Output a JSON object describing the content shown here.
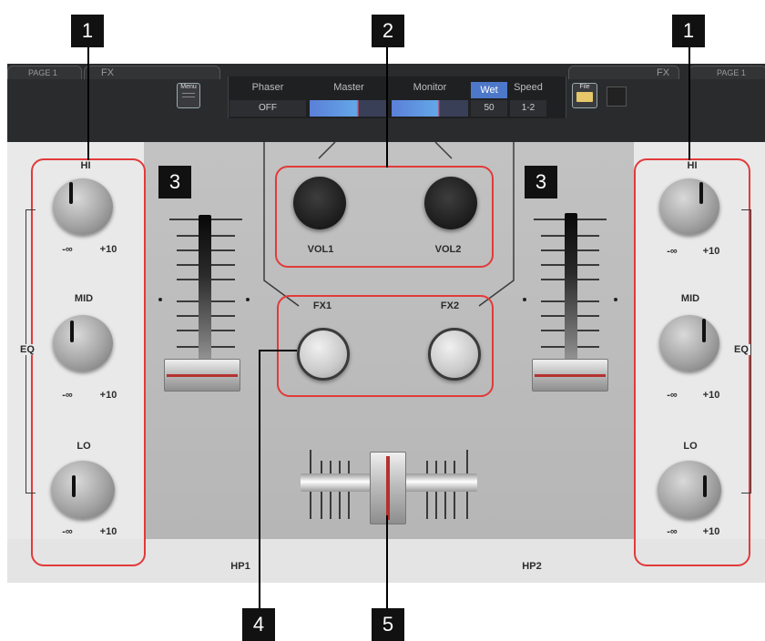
{
  "callouts": {
    "c1_left": "1",
    "c1_right": "1",
    "c2": "2",
    "c3_left": "3",
    "c3_right": "3",
    "c4": "4",
    "c5": "5"
  },
  "topbar": {
    "left_page": "PAGE 1",
    "left_fx": "FX",
    "right_fx": "FX",
    "right_page": "PAGE 1",
    "menu_btn": "Menu",
    "file_btn": "File",
    "phaser_label": "Phaser",
    "phaser_value": "OFF",
    "master_label": "Master",
    "monitor_label": "Monitor",
    "wet_label": "Wet",
    "wet_value": "50",
    "speed_label": "Speed",
    "speed_value": "1-2"
  },
  "eq": {
    "hi": "HI",
    "mid": "MID",
    "lo": "LO",
    "eq": "EQ",
    "min": "-∞",
    "max": "+10"
  },
  "volume": {
    "vol1": "VOL1",
    "vol2": "VOL2"
  },
  "fx": {
    "fx1": "FX1",
    "fx2": "FX2"
  },
  "headphones": {
    "hp1": "HP1",
    "hp2": "HP2"
  },
  "colors": {
    "highlight": "#e23a3a",
    "wet_accent": "#4d78c9"
  }
}
